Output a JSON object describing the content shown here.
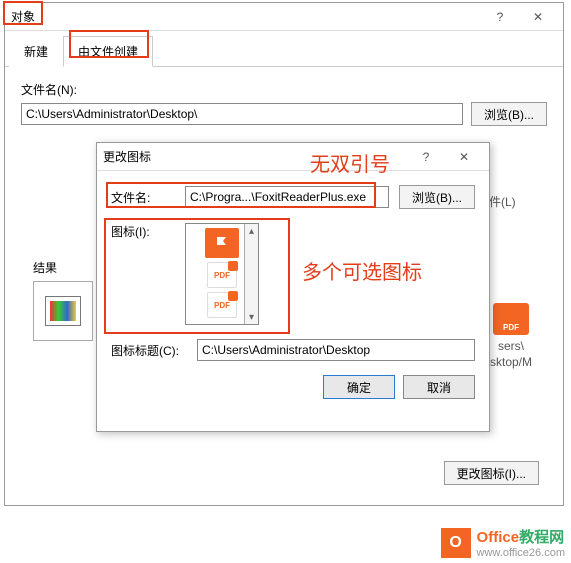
{
  "dlg1": {
    "title": "对象",
    "tabs": {
      "new": "新建",
      "fromfile": "由文件创建"
    },
    "filename_label": "文件名(N):",
    "filename_value": "C:\\Users\\Administrator\\Desktop\\",
    "browse": "浏览(B)...",
    "link_label": "件(L)",
    "result_label": "结果",
    "misc1": "sers\\",
    "misc2": "sktop/M",
    "change_icon_btn": "更改图标(I)..."
  },
  "dlg2": {
    "title": "更改图标",
    "filename_label": "文件名:",
    "filename_value": "C:\\Progra...\\FoxitReaderPlus.exe",
    "browse": "浏览(B)...",
    "icon_label": "图标(I):",
    "caption_label": "图标标题(C):",
    "caption_value": "C:\\Users\\Administrator\\Desktop",
    "ok": "确定",
    "cancel": "取消",
    "pdf_label": "PDF"
  },
  "annotations": {
    "noquotes": "无双引号",
    "multiicons": "多个可选图标"
  },
  "footer": {
    "brand1": "Office",
    "brand2": "教程网",
    "url": "www.office26.com"
  }
}
